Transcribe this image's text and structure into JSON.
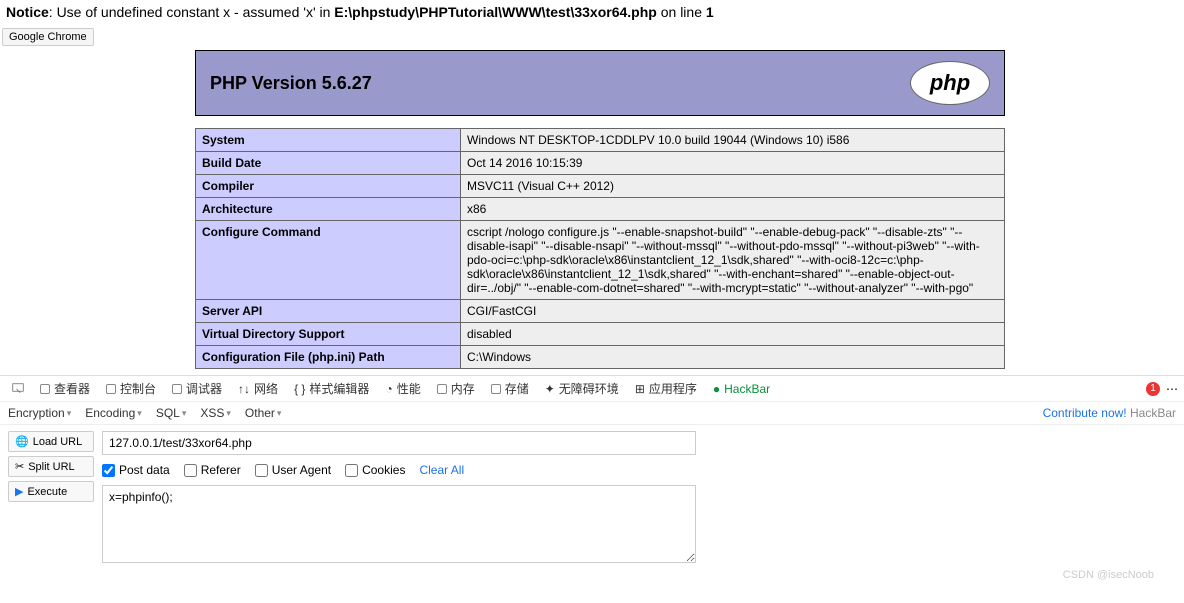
{
  "notice": {
    "label": "Notice",
    "message": ": Use of undefined constant x - assumed 'x' in ",
    "file": "E:\\phpstudy\\PHPTutorial\\WWW\\test\\33xor64.php",
    "tail": " on line ",
    "line": "1"
  },
  "browser_badge": "Google Chrome",
  "php": {
    "title": "PHP Version 5.6.27",
    "logo_text": "php",
    "rows": [
      {
        "k": "System",
        "v": "Windows NT DESKTOP-1CDDLPV 10.0 build 19044 (Windows 10) i586"
      },
      {
        "k": "Build Date",
        "v": "Oct 14 2016 10:15:39"
      },
      {
        "k": "Compiler",
        "v": "MSVC11 (Visual C++ 2012)"
      },
      {
        "k": "Architecture",
        "v": "x86"
      },
      {
        "k": "Configure Command",
        "v": "cscript /nologo configure.js \"--enable-snapshot-build\" \"--enable-debug-pack\" \"--disable-zts\" \"--disable-isapi\" \"--disable-nsapi\" \"--without-mssql\" \"--without-pdo-mssql\" \"--without-pi3web\" \"--with-pdo-oci=c:\\php-sdk\\oracle\\x86\\instantclient_12_1\\sdk,shared\" \"--with-oci8-12c=c:\\php-sdk\\oracle\\x86\\instantclient_12_1\\sdk,shared\" \"--with-enchant=shared\" \"--enable-object-out-dir=../obj/\" \"--enable-com-dotnet=shared\" \"--with-mcrypt=static\" \"--without-analyzer\" \"--with-pgo\""
      },
      {
        "k": "Server API",
        "v": "CGI/FastCGI"
      },
      {
        "k": "Virtual Directory Support",
        "v": "disabled"
      },
      {
        "k": "Configuration File (php.ini) Path",
        "v": "C:\\Windows"
      }
    ]
  },
  "devtools": {
    "tabs": {
      "inspector": "查看器",
      "console": "控制台",
      "debugger": "调试器",
      "network": "网络",
      "style": "样式编辑器",
      "performance": "性能",
      "memory": "内存",
      "storage": "存储",
      "accessibility": "无障碍环境",
      "application": "应用程序",
      "hackbar": "HackBar"
    },
    "errors": "1",
    "close_icon": "close-icon"
  },
  "hackbar": {
    "menu": {
      "encryption": "Encryption",
      "encoding": "Encoding",
      "sql": "SQL",
      "xss": "XSS",
      "other": "Other"
    },
    "contribute": "Contribute now!",
    "contribute_tail": " HackBar",
    "buttons": {
      "load": "Load URL",
      "split": "Split URL",
      "execute": "Execute"
    },
    "url": "127.0.0.1/test/33xor64.php",
    "options": {
      "post": "Post data",
      "referer": "Referer",
      "useragent": "User Agent",
      "cookies": "Cookies",
      "clear": "Clear All"
    },
    "body": "x=phpinfo();"
  },
  "watermark": "CSDN @isecNoob"
}
